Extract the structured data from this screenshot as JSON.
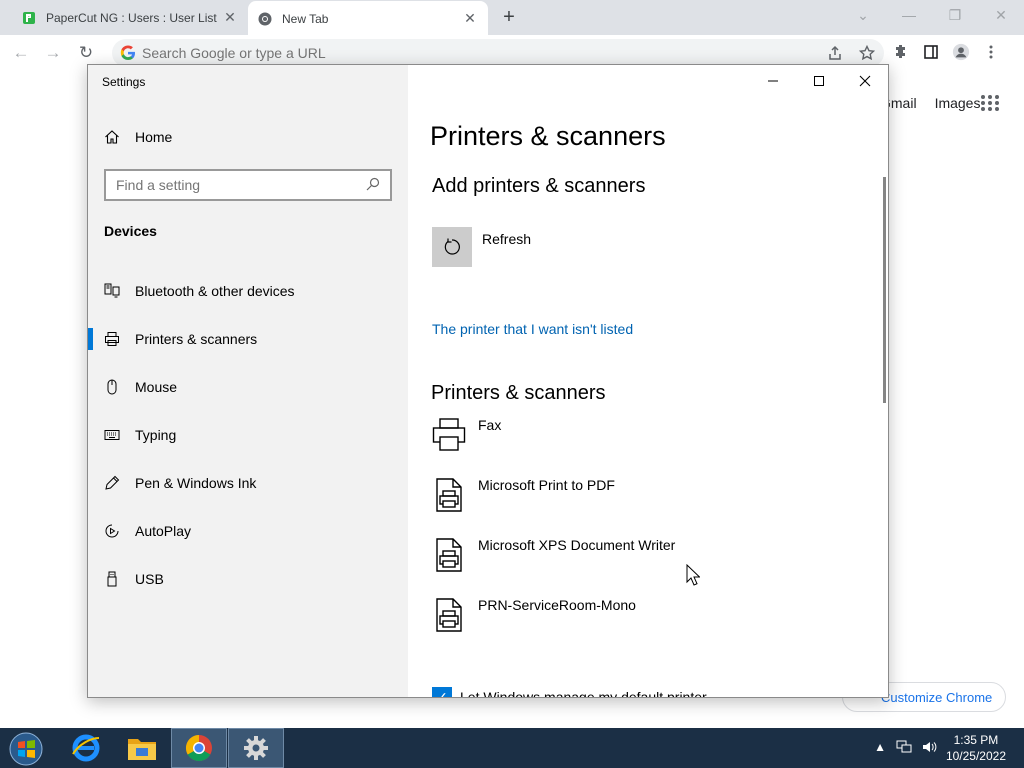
{
  "browser": {
    "tabs": [
      {
        "title": "PaperCut NG : Users : User List",
        "active": false
      },
      {
        "title": "New Tab",
        "active": true
      }
    ],
    "omnibox_placeholder": "Search Google or type a URL",
    "ntp_links": [
      "Gmail",
      "Images"
    ],
    "customize_label": "Customize Chrome"
  },
  "settings": {
    "window_title": "Settings",
    "home_label": "Home",
    "search_placeholder": "Find a setting",
    "section_label": "Devices",
    "nav_items": [
      {
        "label": "Bluetooth & other devices",
        "icon": "bluetooth-icon"
      },
      {
        "label": "Printers & scanners",
        "icon": "printer-icon",
        "selected": true
      },
      {
        "label": "Mouse",
        "icon": "mouse-icon"
      },
      {
        "label": "Typing",
        "icon": "keyboard-icon"
      },
      {
        "label": "Pen & Windows Ink",
        "icon": "pen-icon"
      },
      {
        "label": "AutoPlay",
        "icon": "autoplay-icon"
      },
      {
        "label": "USB",
        "icon": "usb-icon"
      }
    ],
    "content": {
      "page_title": "Printers & scanners",
      "add_heading": "Add printers & scanners",
      "refresh_label": "Refresh",
      "not_listed_link": "The printer that I want isn't listed",
      "list_heading": "Printers & scanners",
      "printers": [
        "Fax",
        "Microsoft Print to PDF",
        "Microsoft XPS Document Writer",
        "PRN-ServiceRoom-Mono"
      ],
      "default_printer_checkbox": "Let Windows manage my default printer"
    }
  },
  "taskbar": {
    "time": "1:35 PM",
    "date": "10/25/2022"
  },
  "colors": {
    "accent": "#0078d7",
    "link": "#0063b1",
    "taskbar": "#1b2f45"
  }
}
